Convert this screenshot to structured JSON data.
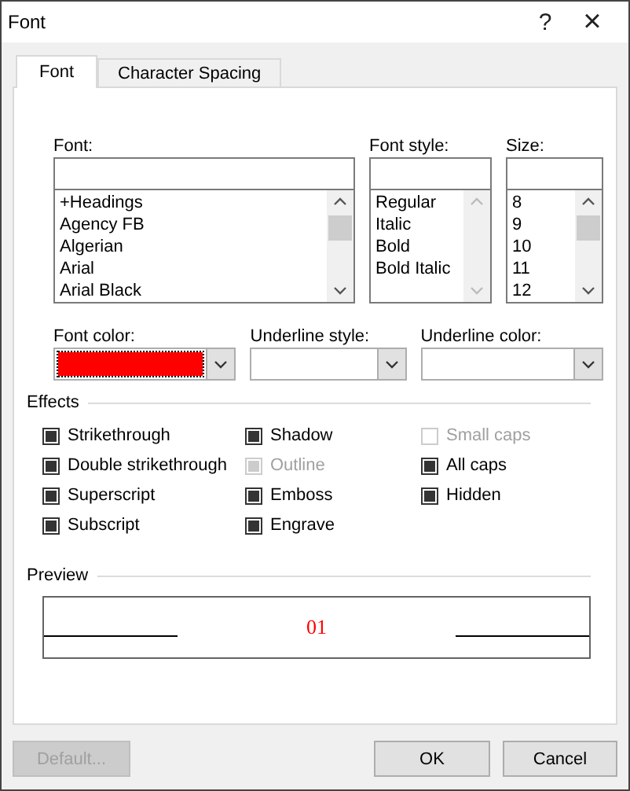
{
  "window": {
    "title": "Font",
    "help": "?",
    "close": "×"
  },
  "tabs": [
    {
      "label": "Font",
      "selected": true
    },
    {
      "label": "Character Spacing",
      "selected": false
    }
  ],
  "font": {
    "label": "Font:",
    "items": [
      "+Headings",
      "Agency FB",
      "Algerian",
      "Arial",
      "Arial Black"
    ]
  },
  "font_style": {
    "label": "Font style:",
    "items": [
      "Regular",
      "Italic",
      "Bold",
      "Bold Italic"
    ]
  },
  "size": {
    "label": "Size:",
    "items": [
      "8",
      "9",
      "10",
      "11",
      "12"
    ]
  },
  "font_color": {
    "label": "Font color:",
    "color": "#ff0000"
  },
  "underline_style": {
    "label": "Underline style:"
  },
  "underline_color": {
    "label": "Underline color:"
  },
  "effects": {
    "label": "Effects",
    "columns": [
      [
        {
          "label": "Strikethrough",
          "indeterminate": true,
          "disabled": false
        },
        {
          "label": "Double strikethrough",
          "indeterminate": true,
          "disabled": false
        },
        {
          "label": "Superscript",
          "indeterminate": true,
          "disabled": false
        },
        {
          "label": "Subscript",
          "indeterminate": true,
          "disabled": false
        }
      ],
      [
        {
          "label": "Shadow",
          "indeterminate": true,
          "disabled": false
        },
        {
          "label": "Outline",
          "indeterminate": true,
          "disabled": true
        },
        {
          "label": "Emboss",
          "indeterminate": true,
          "disabled": false
        },
        {
          "label": "Engrave",
          "indeterminate": true,
          "disabled": false
        }
      ],
      [
        {
          "label": "Small caps",
          "indeterminate": false,
          "disabled": true
        },
        {
          "label": "All caps",
          "indeterminate": true,
          "disabled": false
        },
        {
          "label": "Hidden",
          "indeterminate": true,
          "disabled": false
        }
      ]
    ]
  },
  "preview": {
    "label": "Preview",
    "text": "01"
  },
  "buttons": [
    {
      "label": "Default...",
      "disabled": true
    },
    {
      "label": "OK",
      "disabled": false
    },
    {
      "label": "Cancel",
      "disabled": false
    }
  ]
}
